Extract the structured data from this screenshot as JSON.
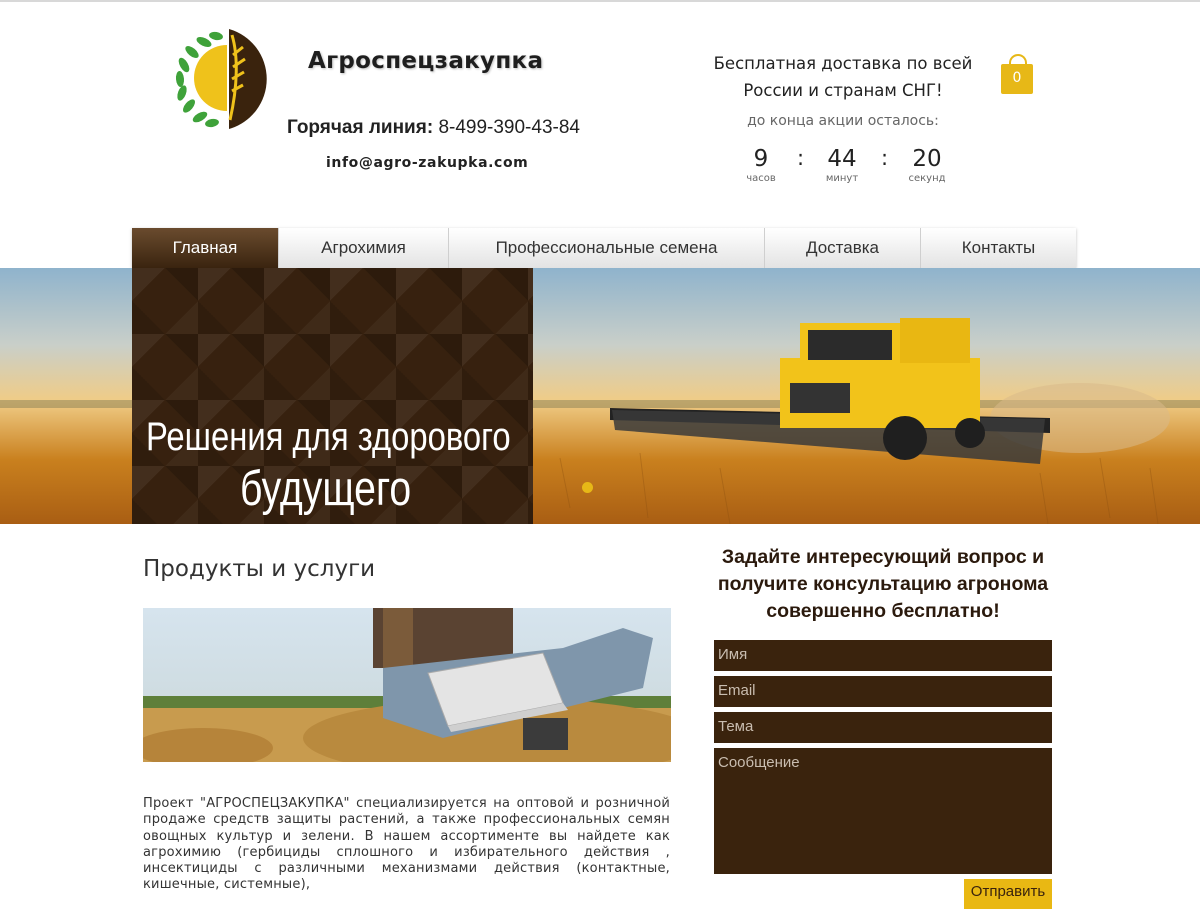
{
  "header": {
    "brand": "Агроспецзакупка",
    "hotline_label": "Горячая линия:",
    "hotline_phone": "8-499-390-43-84",
    "email": "info@agro-zakupka.com",
    "promo_line1": "Бесплатная доставка по всей",
    "promo_line2": "России и странам СНГ!",
    "promo_left": "до конца акции осталось:",
    "countdown": {
      "hours": "9",
      "hours_label": "часов",
      "minutes": "44",
      "minutes_label": "минут",
      "seconds": "20",
      "seconds_label": "секунд",
      "separator": ":"
    },
    "cart_count": "0"
  },
  "nav": {
    "items": [
      {
        "label": "Главная",
        "active": true
      },
      {
        "label": "Агрохимия",
        "active": false
      },
      {
        "label": "Профессиональные семена",
        "active": false
      },
      {
        "label": "Доставка",
        "active": false
      },
      {
        "label": "Контакты",
        "active": false
      }
    ]
  },
  "hero": {
    "line1": "Решения для здорового",
    "line2": "будущего"
  },
  "content": {
    "section_title": "Продукты и услуги",
    "about": "Проект \"АГРОСПЕЦЗАКУПКА\" специализируется на оптовой и розничной продаже средств защиты растений, а также профессиональных семян овощных культур и зелени. В нашем ассортименте вы найдете как агрохимию (гербициды сплошного и избирательного действия , инсектициды с различными механизмами действия (контактные, кишечные, системные),"
  },
  "form": {
    "title": "Задайте интересующий вопрос и получите консультацию агронома совершенно бесплатно!",
    "name_placeholder": "Имя",
    "email_placeholder": "Email",
    "subject_placeholder": "Тема",
    "message_placeholder": "Сообщение",
    "submit_label": "Отправить"
  },
  "colors": {
    "brand_brown": "#3a230d",
    "accent_yellow": "#e7b817",
    "nav_active": "#5a3d22"
  }
}
